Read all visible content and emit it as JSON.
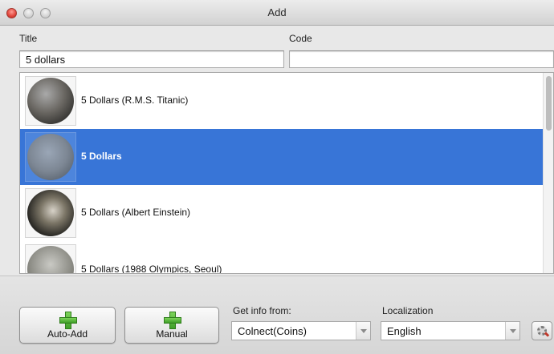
{
  "window": {
    "title": "Add",
    "icons": [
      "close-icon",
      "minimize-icon",
      "zoom-icon"
    ]
  },
  "form": {
    "title_label": "Title",
    "title_value": "5 dollars",
    "code_label": "Code",
    "code_value": ""
  },
  "results": {
    "selected_index": 1,
    "items": [
      {
        "label": "5 Dollars (R.M.S. Titanic)"
      },
      {
        "label": "5 Dollars"
      },
      {
        "label": "5 Dollars (Albert Einstein)"
      },
      {
        "label": "5 Dollars (1988 Olympics, Seoul)"
      }
    ]
  },
  "buttons": {
    "auto_add_label": "Auto-Add",
    "manual_label": "Manual",
    "plus_icon": "plus-icon",
    "settings_icon": "gear-icon"
  },
  "source": {
    "label": "Get info from:",
    "selected": "Colnect(Coins)"
  },
  "localization": {
    "label": "Localization",
    "selected": "English"
  },
  "colors": {
    "selection": "#3875d7",
    "plus": "#4caf2f",
    "close_button": "#e0443a"
  }
}
